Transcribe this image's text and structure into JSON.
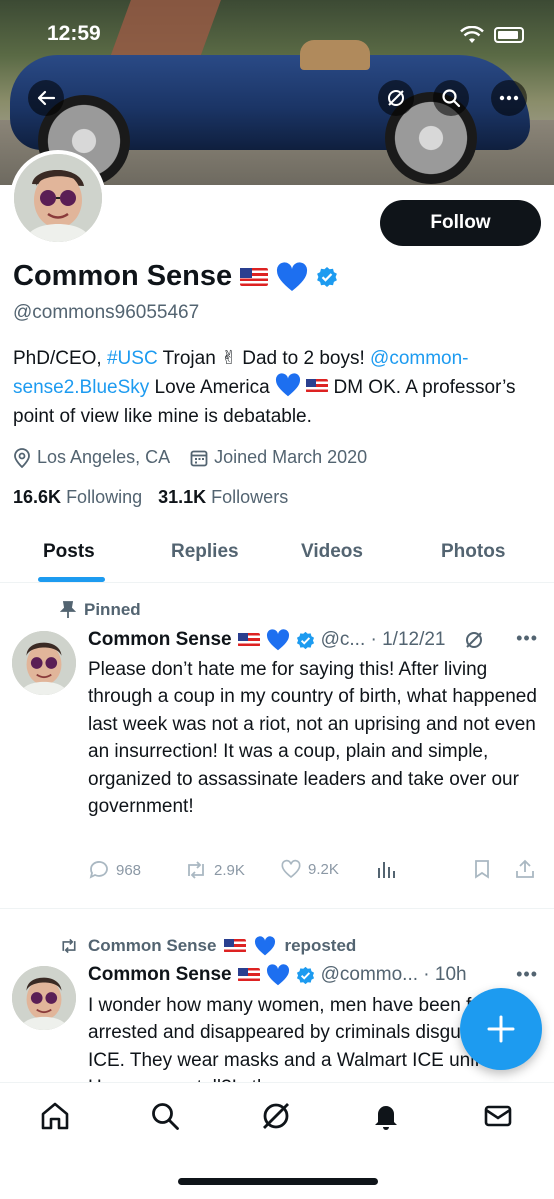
{
  "status_bar": {
    "time": "12:59"
  },
  "profile": {
    "name": "Common Sense",
    "handle": "@commons96055467",
    "follow_label": "Follow",
    "bio": {
      "p1": "PhD/CEO, ",
      "hashtag": "#USC",
      "p2": " Trojan ✌ Dad to 2 boys! ",
      "mention": "@common-sense2.BlueSky",
      "p3": " Love America ",
      "p4": " DM OK. A professor’s point of view like mine is debatable."
    },
    "location": "Los Angeles, CA",
    "joined": "Joined March 2020",
    "following_count": "16.6K",
    "following_label": "Following",
    "followers_count": "31.1K",
    "followers_label": "Followers"
  },
  "tabs": [
    "Posts",
    "Replies",
    "Videos",
    "Photos"
  ],
  "posts": [
    {
      "context": "Pinned",
      "name": "Common Sense",
      "handle_date": "@c... · 1/12/21",
      "text": "Please don’t hate me for saying this! After living through a coup in my country of birth, what happened last week was not a riot, not an uprising and not even an insurrection! It was a coup, plain and simple, organized to assassinate leaders and take over our government!",
      "replies": "968",
      "reposts": "2.9K",
      "likes": "9.2K"
    },
    {
      "context_name": "Common Sense",
      "context_suffix": "reposted",
      "name": "Common Sense",
      "handle_date": "@commo... · 10h",
      "text": "I wonder how many women, men have been fake arrested and disappeared by criminals disguised as ICE. They wear masks and a Walmart ICE uniform. How can we tell?Is th"
    }
  ],
  "colors": {
    "accent": "#1d9bf0",
    "text": "#0f1419",
    "muted": "#536471"
  }
}
